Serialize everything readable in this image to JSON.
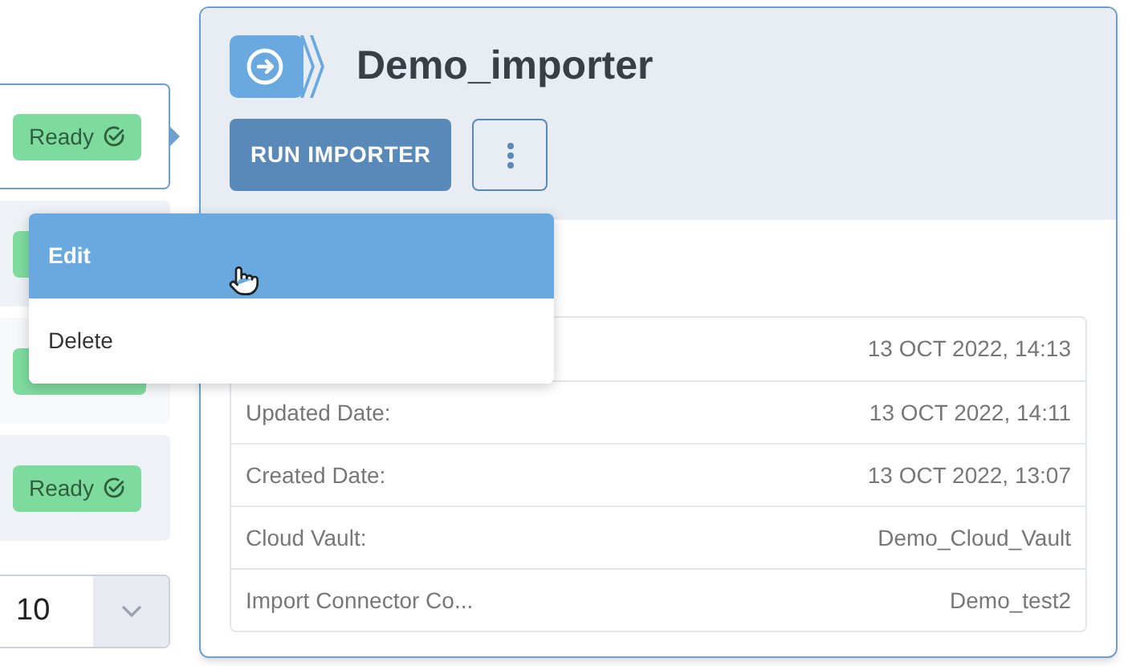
{
  "list_rows": [
    {
      "selected": true,
      "status": "Ready"
    },
    {
      "selected": false
    },
    {
      "selected": false
    },
    {
      "selected": false,
      "status": "Ready"
    }
  ],
  "page_size": {
    "value": "10"
  },
  "detail": {
    "title": "Demo_importer",
    "run_button": "RUN IMPORTER",
    "properties": [
      {
        "value": "13 OCT 2022, 14:13"
      },
      {
        "label": "Updated Date:",
        "value": "13 OCT 2022, 14:11"
      },
      {
        "label": "Created Date:",
        "value": "13 OCT 2022, 13:07"
      },
      {
        "label": "Cloud Vault:",
        "value": "Demo_Cloud_Vault"
      },
      {
        "label": "Import Connector Co...",
        "value": "Demo_test2"
      }
    ]
  },
  "menu": {
    "items": [
      {
        "label": "Edit",
        "selected": true
      },
      {
        "label": "Delete",
        "selected": false
      }
    ]
  }
}
